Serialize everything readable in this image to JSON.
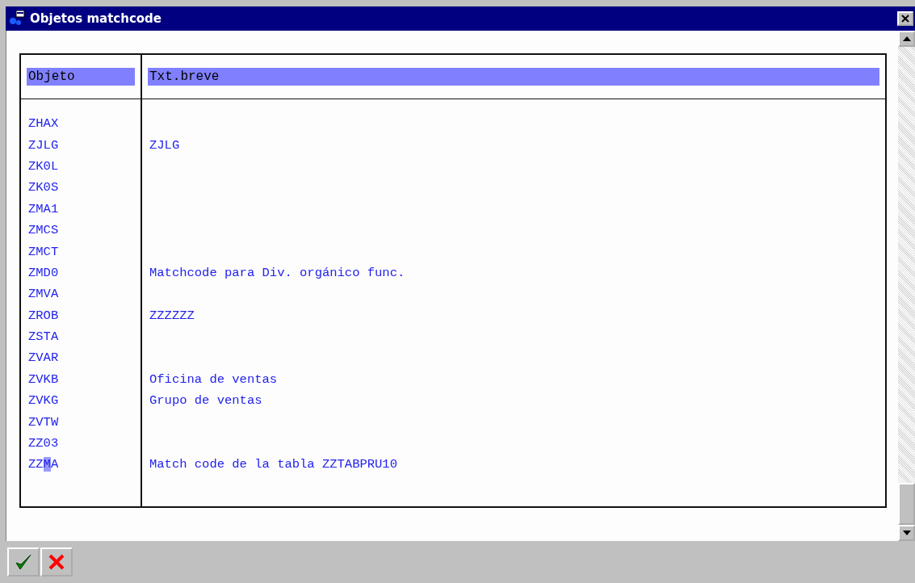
{
  "window": {
    "title": "Objetos matchcode"
  },
  "table": {
    "columns": [
      "Objeto",
      "Txt.breve"
    ],
    "rows": [
      {
        "object": "ZHAX",
        "text": "",
        "focused": false
      },
      {
        "object": "ZJLG",
        "text": "ZJLG",
        "focused": false
      },
      {
        "object": "ZK0L",
        "text": "",
        "focused": false
      },
      {
        "object": "ZK0S",
        "text": "",
        "focused": false
      },
      {
        "object": "ZMA1",
        "text": "",
        "focused": false
      },
      {
        "object": "ZMCS",
        "text": "",
        "focused": false
      },
      {
        "object": "ZMCT",
        "text": "",
        "focused": false
      },
      {
        "object": "ZMD0",
        "text": "Matchcode para Div. orgánico func.",
        "focused": false
      },
      {
        "object": "ZMVA",
        "text": "",
        "focused": false
      },
      {
        "object": "ZROB",
        "text": "ZZZZZZ",
        "focused": false
      },
      {
        "object": "ZSTA",
        "text": "",
        "focused": false
      },
      {
        "object": "ZVAR",
        "text": "",
        "focused": false
      },
      {
        "object": "ZVKB",
        "text": "Oficina de ventas",
        "focused": false
      },
      {
        "object": "ZVKG",
        "text": "Grupo de ventas",
        "focused": false
      },
      {
        "object": "ZVTW",
        "text": "",
        "focused": false
      },
      {
        "object": "ZZ03",
        "text": "",
        "focused": false
      },
      {
        "object": "ZZMA",
        "text": "Match code de la tabla ZZTABPRU10",
        "focused": true
      }
    ]
  },
  "buttons": [
    {
      "kind": "confirm"
    },
    {
      "kind": "cancel"
    }
  ]
}
